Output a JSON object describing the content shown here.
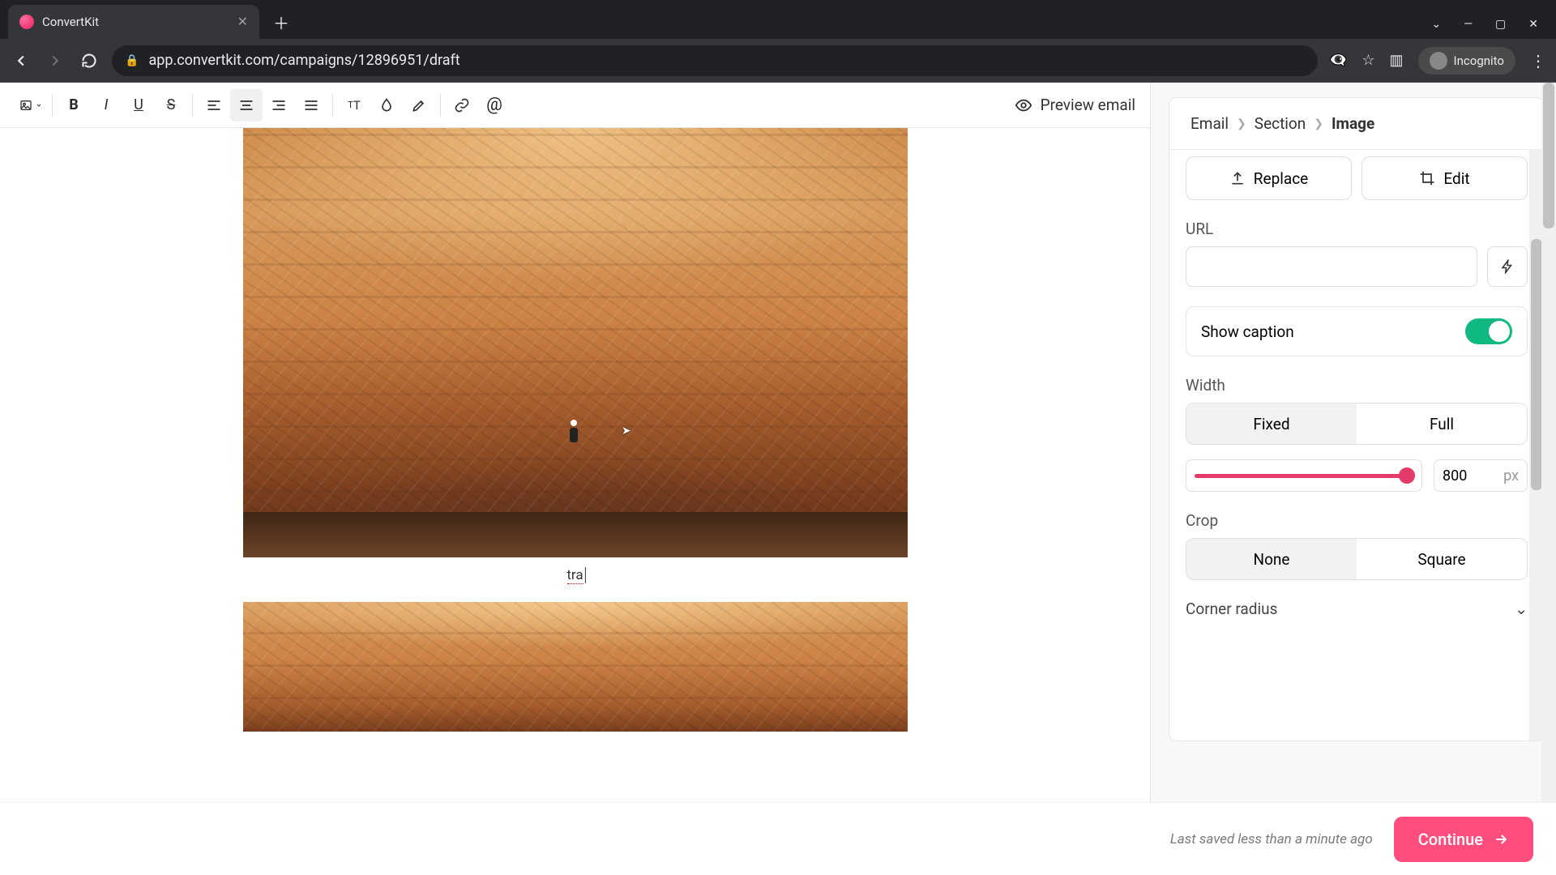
{
  "browser": {
    "tab_title": "ConvertKit",
    "url": "app.convertkit.com/campaigns/12896951/draft",
    "incognito_label": "Incognito"
  },
  "toolbar": {
    "preview_label": "Preview email"
  },
  "canvas": {
    "caption_text": "tra"
  },
  "breadcrumb": {
    "level1": "Email",
    "level2": "Section",
    "level3": "Image"
  },
  "panel": {
    "replace_label": "Replace",
    "edit_label": "Edit",
    "url_label": "URL",
    "url_value": "",
    "show_caption_label": "Show caption",
    "show_caption_on": true,
    "width_label": "Width",
    "width_options": {
      "fixed": "Fixed",
      "full": "Full"
    },
    "width_value": "800",
    "width_unit": "px",
    "crop_label": "Crop",
    "crop_options": {
      "none": "None",
      "square": "Square"
    },
    "corner_radius_label": "Corner radius"
  },
  "footer": {
    "saved_text": "Last saved less than a minute ago",
    "continue_label": "Continue"
  }
}
